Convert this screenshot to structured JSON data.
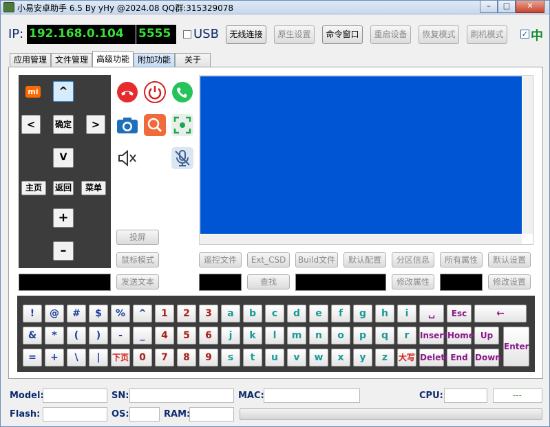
{
  "window": {
    "title": "小易安卓助手 6.5 By yHy @2024.08 QQ群:315329078",
    "controls": [
      "–",
      "□",
      "✕"
    ]
  },
  "toolbar": {
    "ip_label": "IP:",
    "ip_value": "192.168.0.104",
    "port_value": "5555",
    "usb_label": "USB",
    "usb_checked": false,
    "buttons": [
      "无线连接",
      "原生设置",
      "命令窗口",
      "重启设备",
      "恢复模式",
      "刷机模式"
    ],
    "lang_label": "中",
    "lang_checked": true
  },
  "tabs": [
    "应用管理",
    "文件管理",
    "高级功能",
    "附加功能",
    "关于"
  ],
  "active_tab": "高级功能",
  "remote": {
    "logo": "mi",
    "up": "^",
    "left": "<",
    "ok": "确定",
    "right": ">",
    "down": "V",
    "home": "主页",
    "back": "返回",
    "menu": "菜单",
    "vol_up": "+",
    "vol_down": "–"
  },
  "side_buttons": {
    "cast": "投屏",
    "mouse_mode": "鼠标模式",
    "send_text": "发送文本"
  },
  "icons": [
    "hangup-icon",
    "power-icon",
    "phone-icon",
    "camera-icon",
    "search-icon",
    "screenshot-icon",
    "mute-icon",
    "mic-icon"
  ],
  "action_buttons_row1": [
    "遥控文件",
    "Ext_CSD",
    "Build文件",
    "默认配置",
    "分区信息",
    "所有属性",
    "默认设置"
  ],
  "action_buttons_row2": {
    "find": "查找",
    "modify_prop": "修改属性",
    "modify_settings": "修改设置"
  },
  "keyboard": {
    "row1": [
      "!",
      "@",
      "#",
      "$",
      "%",
      "^",
      "1",
      "2",
      "3",
      "a",
      "b",
      "c",
      "d",
      "e",
      "f",
      "g",
      "h",
      "i",
      "␣",
      "Esc",
      "←"
    ],
    "row2": [
      "&",
      "*",
      "(",
      ")",
      "-",
      "_",
      "4",
      "5",
      "6",
      "j",
      "k",
      "l",
      "m",
      "n",
      "o",
      "p",
      "q",
      "r",
      "Insert",
      "Home",
      "Up"
    ],
    "row3": [
      "=",
      "+",
      "\\",
      "|",
      "下页",
      "0",
      "7",
      "8",
      "9",
      "s",
      "t",
      "u",
      "v",
      "w",
      "x",
      "y",
      "z",
      "大写",
      "Delete",
      "End",
      "Down"
    ],
    "enter": "Enter"
  },
  "status": {
    "model_label": "Model:",
    "sn_label": "SN:",
    "mac_label": "MAC:",
    "cpu_label": "CPU:",
    "cpu_value": "---",
    "flash_label": "Flash:",
    "os_label": "OS:",
    "ram_label": "RAM:"
  },
  "colors": {
    "accent_blue": "#0055d4",
    "ip_green": "#36e036",
    "tab_active_bg": "#ffffff"
  }
}
